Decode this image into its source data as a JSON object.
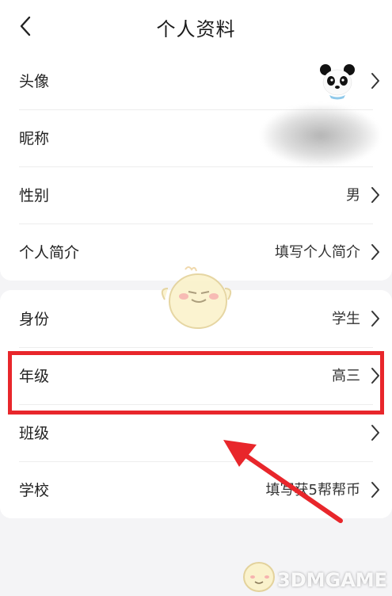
{
  "header": {
    "title": "个人资料",
    "back_icon": "chevron-left-icon"
  },
  "section1": {
    "rows": [
      {
        "label": "头像",
        "value": "",
        "avatar_icon": "panda-avatar-icon"
      },
      {
        "label": "昵称",
        "value": ""
      },
      {
        "label": "性别",
        "value": "男"
      },
      {
        "label": "个人简介",
        "value": "填写个人简介"
      }
    ]
  },
  "section2": {
    "rows": [
      {
        "label": "身份",
        "value": "学生"
      },
      {
        "label": "年级",
        "value": "高三"
      },
      {
        "label": "班级",
        "value": ""
      },
      {
        "label": "学校",
        "value": "填写获5帮帮币"
      }
    ]
  },
  "annotation": {
    "highlight_color": "#e8262b",
    "arrow_color": "#e8262b"
  },
  "watermark": {
    "text": "3DMGAME"
  }
}
